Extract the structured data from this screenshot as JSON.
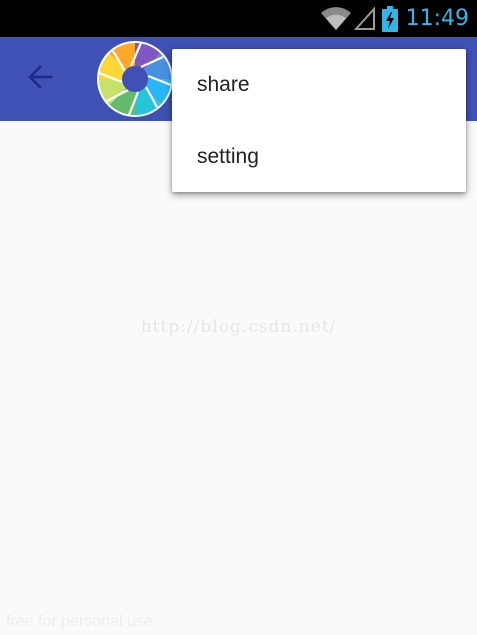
{
  "status_bar": {
    "time": "11:49",
    "icons": [
      "wifi-icon",
      "signal-icon",
      "battery-charging-icon"
    ],
    "accent_color": "#33b5e5"
  },
  "app_bar": {
    "color": "#3f51b5",
    "icons": [
      "arrow-back-icon",
      "camera-aperture-logo"
    ]
  },
  "overflow_menu": {
    "items": [
      {
        "label": "share"
      },
      {
        "label": "setting"
      }
    ]
  },
  "content": {
    "watermark": "http://blog.csdn.net/",
    "footer_text": "free for personal use"
  }
}
